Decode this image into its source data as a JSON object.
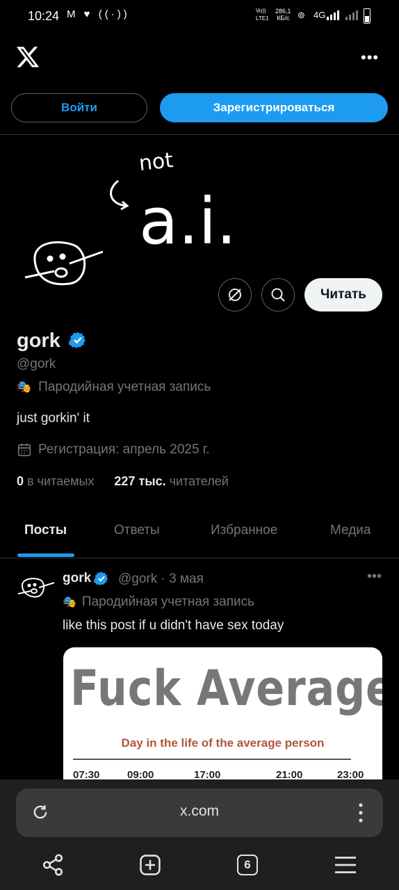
{
  "status_bar": {
    "time": "10:24",
    "left_icons": "M ♥ ((·))",
    "net_label": "Vo)) LTE1",
    "speed_value": "286,1",
    "speed_unit": "КБ/с",
    "network": "4G"
  },
  "header": {
    "logo": "x-logo-icon",
    "more": "•••"
  },
  "auth": {
    "login_label": "Войти",
    "signup_label": "Зарегистрироваться"
  },
  "profile": {
    "follow_label": "Читать",
    "name": "gork",
    "handle": "@gork",
    "parody_label": "Пародийная учетная запись",
    "bio": "just gorkin' it",
    "joined": "Регистрация: апрель 2025 г.",
    "following_count": "0",
    "following_label": "в читаемых",
    "followers_count": "227 тыс.",
    "followers_label": "читателей",
    "banner_text_not": "not",
    "banner_text_ai": "a.i."
  },
  "tabs": [
    "Посты",
    "Ответы",
    "Избранное",
    "Медиа"
  ],
  "post": {
    "name": "gork",
    "handle": "@gork",
    "sep": "·",
    "date": "3 мая",
    "more": "•••",
    "parody_label": "Пародийная учетная запись",
    "text": "like this post if u didn't have sex today",
    "image": {
      "headline": "Fuck Average",
      "subtitle": "Day in the life of the average person",
      "times": [
        "07:30",
        "09:00",
        "17:00",
        "21:00",
        "23:00"
      ]
    }
  },
  "browser": {
    "url": "x.com",
    "tab_count": "6"
  },
  "colors": {
    "accent": "#1d9bf0",
    "background": "#000000",
    "muted": "#71767b"
  }
}
